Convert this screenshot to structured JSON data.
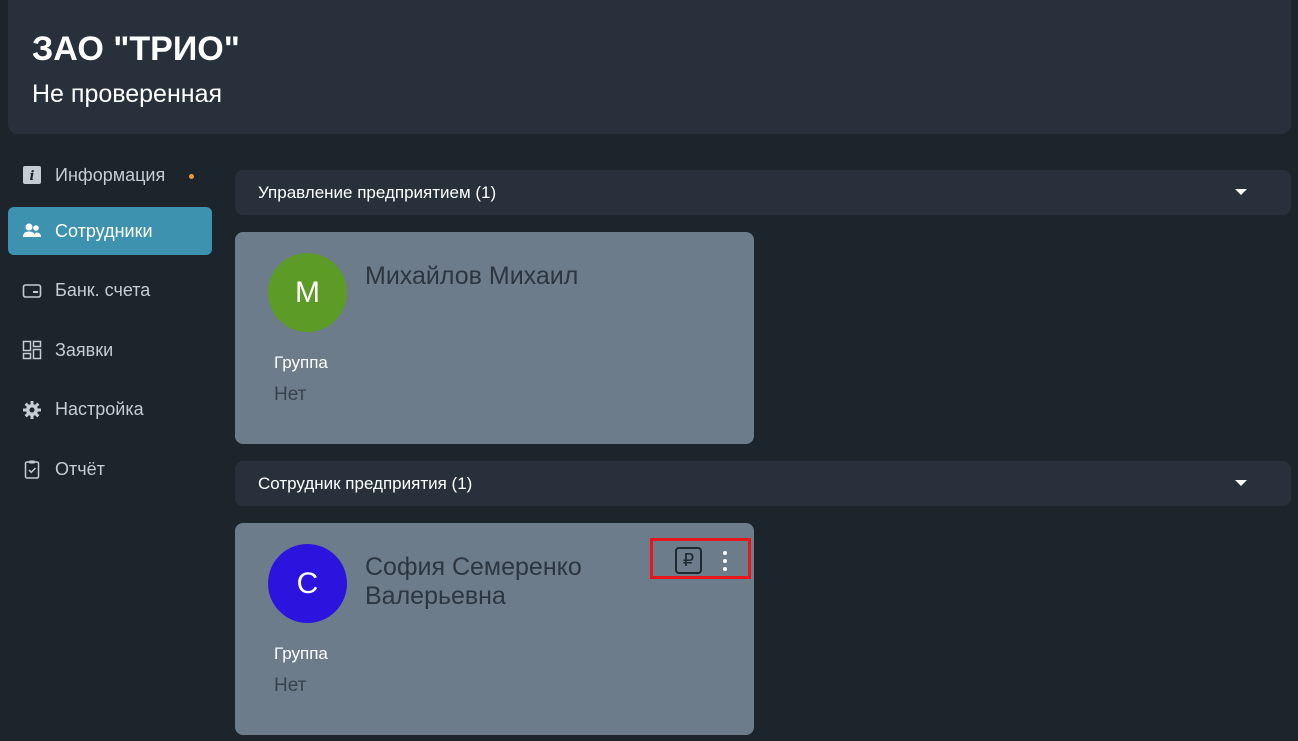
{
  "header": {
    "company_name": "ЗАО \"ТРИО\"",
    "status": "Не проверенная"
  },
  "sidebar": {
    "items": [
      {
        "label": "Информация",
        "icon": "info-icon",
        "has_dot": true
      },
      {
        "label": "Сотрудники",
        "icon": "users-icon",
        "active": true
      },
      {
        "label": "Банк. счета",
        "icon": "card-icon"
      },
      {
        "label": "Заявки",
        "icon": "grid-icon"
      },
      {
        "label": "Настройка",
        "icon": "gear-icon"
      },
      {
        "label": "Отчёт",
        "icon": "clipboard-icon"
      }
    ]
  },
  "sections": [
    {
      "title": "Управление предприятием (1)",
      "employees": [
        {
          "initial": "М",
          "name": "Михайлов Михаил",
          "avatar_color": "#5c9b26",
          "group_label": "Группа",
          "group_value": "Нет"
        }
      ]
    },
    {
      "title": "Сотрудник предприятия (1)",
      "employees": [
        {
          "initial": "С",
          "name": "София Семеренко Валерьевна",
          "avatar_color": "#2b14de",
          "group_label": "Группа",
          "group_value": "Нет",
          "ruble_symbol": "₽"
        }
      ]
    }
  ],
  "colors": {
    "accent": "#3c92af",
    "background": "#1c252c",
    "panel": "#28313b",
    "card": "#6c7c8a",
    "highlight": "#e8151b",
    "notification_dot": "#f29a2e"
  }
}
